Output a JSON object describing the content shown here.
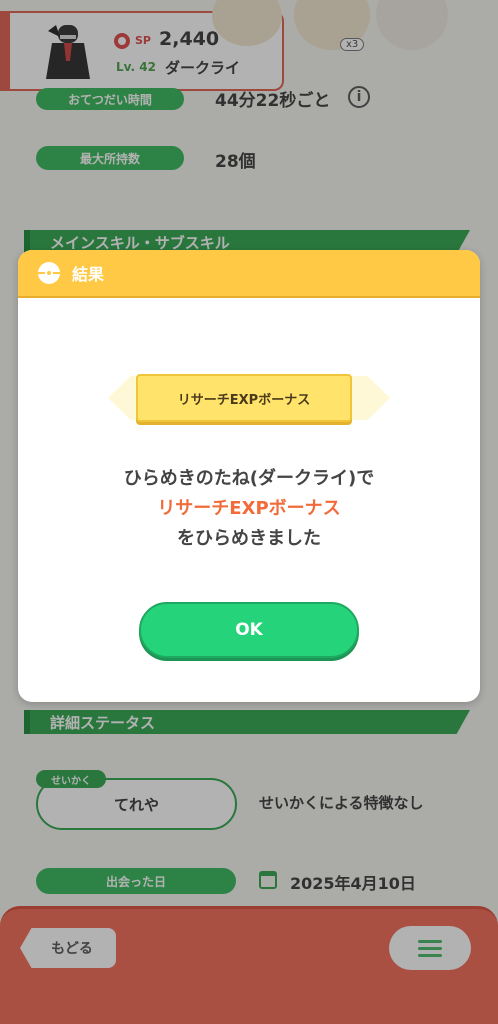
{
  "background": {
    "pokemon": {
      "sp_label": "SP",
      "sp_value": "2,440",
      "level": "Lv. 42",
      "name": "ダークライ"
    },
    "ingredient_count": "x3",
    "help_interval": {
      "label": "おてつだい時間",
      "value": "44分22秒ごと"
    },
    "max_carry": {
      "label": "最大所持数",
      "value": "28個"
    },
    "skills_section": "メインスキル・サブスキル",
    "detail_section": "詳細ステータス",
    "nature": {
      "tag": "せいかく",
      "value": "てれや",
      "desc": "せいかくによる特徴なし"
    },
    "met": {
      "label": "出会った日",
      "value": "2025年4月10日"
    },
    "back_label": "もどる"
  },
  "dialog": {
    "title": "結果",
    "skill_name": "リサーチEXPボーナス",
    "line1": "ひらめきのたね(ダークライ)で",
    "line2": "リサーチEXPボーナス",
    "line3": "をひらめきました",
    "ok_label": "OK"
  },
  "colors": {
    "header": "#ffc845",
    "ok_button": "#25d37a",
    "accent_red": "#f26b3a",
    "bottom_bar": "#f26b55"
  }
}
